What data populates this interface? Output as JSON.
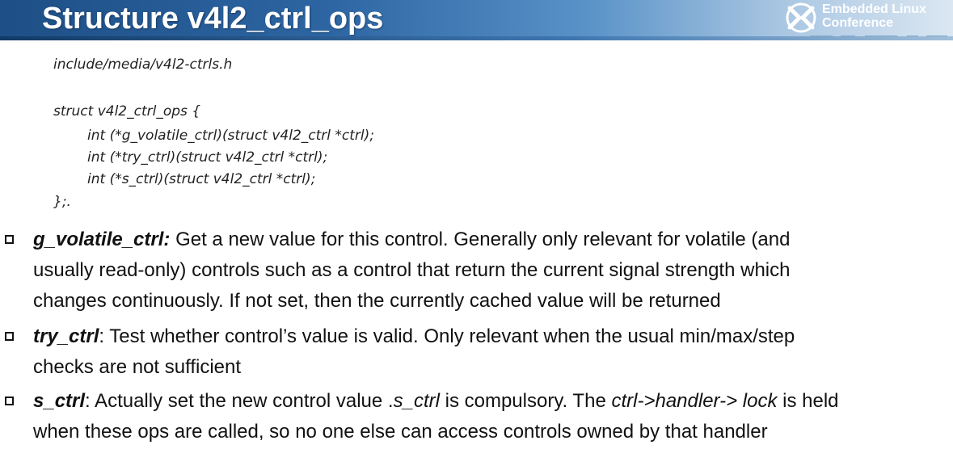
{
  "slide": {
    "title": "Structure v4l2_ctrl_ops",
    "logo": {
      "line1": "Embedded Linux",
      "line2": "Conference",
      "icon": "elc-logo-icon"
    }
  },
  "code": {
    "path": "include/media/v4l2-ctrls.h",
    "lines": [
      "struct v4l2_ctrl_ops {",
      "int (*g_volatile_ctrl)(struct v4l2_ctrl *ctrl);",
      "int (*try_ctrl)(struct v4l2_ctrl *ctrl);",
      "int (*s_ctrl)(struct v4l2_ctrl *ctrl);",
      "};."
    ]
  },
  "bullets": [
    {
      "term": "g_volatile_ctrl",
      "sep": ":",
      "line1": " Get a new value for this control. Generally only relevant for volatile (and",
      "line2": "usually read-only) controls such as a control that return the current signal strength which",
      "line3": "changes continuously. If not set, then the currently cached value will be returned"
    },
    {
      "term": "try_ctrl",
      "line1": ": Test whether control’s value is valid. Only relevant when the usual min/max/step",
      "line2": "checks are not sufficient"
    },
    {
      "term": "s_ctrl",
      "line1a": ": Actually set the new control value .",
      "line1b": "s_ctrl",
      "line1c": " is compulsory. The ",
      "line1d": "ctrl->handler-> lock",
      "line1e": " is held",
      "line2": "when these ops are called, so no one else can access controls owned by that handler"
    }
  ]
}
